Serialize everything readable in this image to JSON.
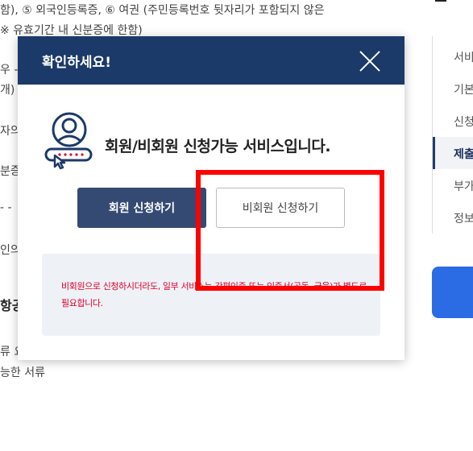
{
  "background": {
    "lines": [
      "함), ⑤ 외국인등록증, ⑥ 여권 (주민등록번호 뒷자리가 포함되지 않은",
      "※ 유효기간 내 신분증에 한함)",
      "우 -",
      "개)",
      "자의",
      "분증",
      "- -",
      "인의",
      "항공",
      "류 요",
      "능한 서류"
    ]
  },
  "side_nav": {
    "items": [
      "서비",
      "기본",
      "신청",
      "제출",
      "부가",
      "정보"
    ],
    "active_index": 3
  },
  "modal": {
    "title": "확인하세요!",
    "close_label": "",
    "info_text": "회원/비회원 신청가능 서비스입니다.",
    "member_button": "회원 신청하기",
    "nonmember_button": "비회원 신청하기",
    "notice": "비회원으로 신청하시더라도, 일부 서비스는 간편인증 또는 인증서(공동, 금융)가 별도로 필요합니다."
  },
  "colors": {
    "header": "#1b3a69",
    "member_button": "#354a73",
    "notice_text": "#e0002a",
    "highlight": "#ff0000"
  }
}
